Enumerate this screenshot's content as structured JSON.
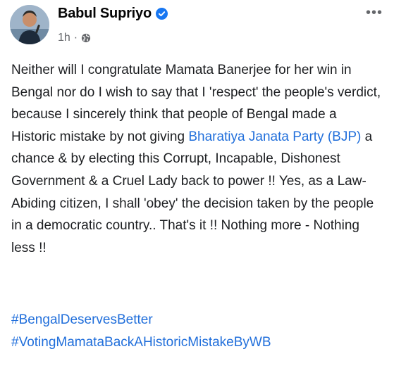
{
  "post": {
    "author_name": "Babul Supriyo",
    "time": "1h",
    "separator": "·",
    "privacy_icon": "globe-icon",
    "verified_icon": "verified-badge-icon",
    "more_icon": "more-options-icon",
    "more_glyph": "•••",
    "text_part1": "Neither will I congratulate Mamata Banerjee for her win in Bengal nor do I wish to say that I 'respect' the people's verdict, because I sincerely think that people of Bengal made a Historic mistake by not giving ",
    "link_text": "Bharatiya Janata Party (BJP)",
    "text_part2": " a chance & by electing this Corrupt, Incapable, Dishonest Government & a Cruel Lady back to power !! Yes, as a Law-Abiding citizen, I shall 'obey' the decision taken by the people in a democratic country.. That's it !! Nothing more - Nothing less !!",
    "hashtags": [
      "#BengalDeservesBetter",
      "#VotingMamataBackAHistoricMistakeByWB"
    ]
  },
  "colors": {
    "link": "#216fdb",
    "verified": "#1877f2",
    "meta": "#65676b",
    "text": "#1c1e21"
  }
}
